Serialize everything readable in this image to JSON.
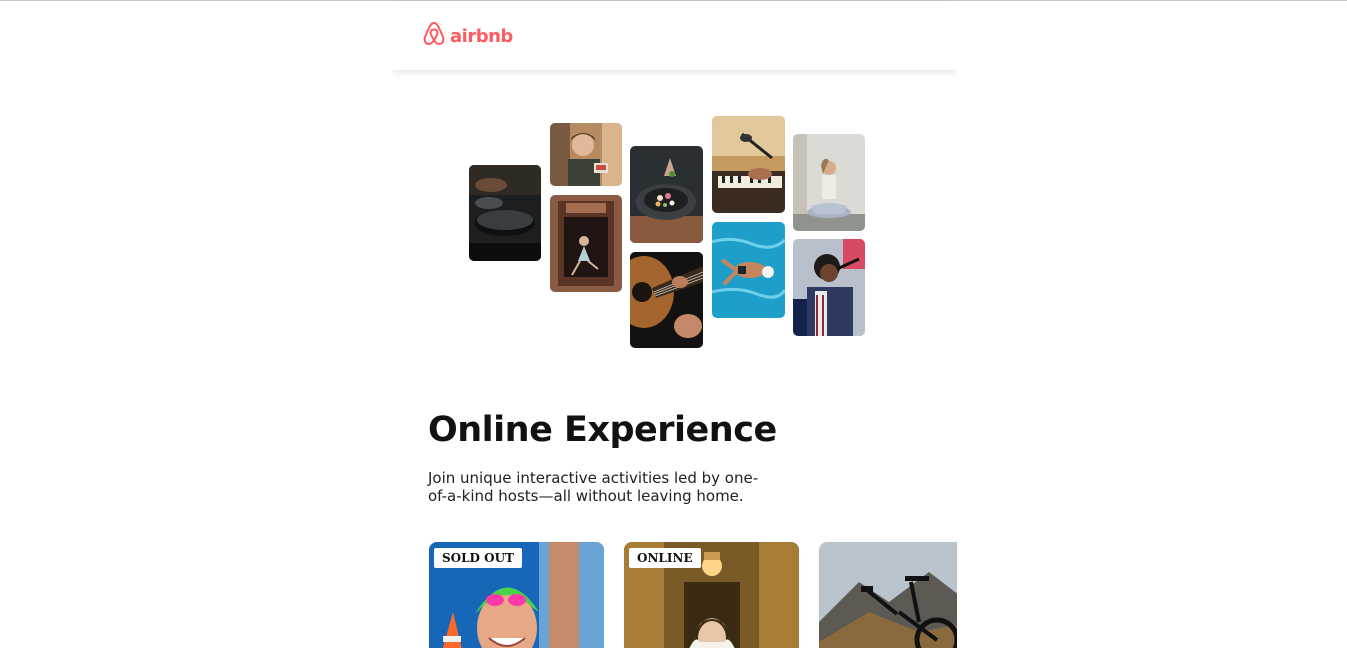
{
  "brand": {
    "name": "airbnb",
    "color": "#ff5a5f",
    "icon": "airbnb-logo-icon"
  },
  "hero": {
    "images": [
      "cooking-pans-photo",
      "chef-woman-photo",
      "dancer-doorway-photo",
      "food-bowl-photo",
      "guitar-photo",
      "microphone-keyboard-photo",
      "swimmer-photo",
      "yoga-photo",
      "singer-photo"
    ]
  },
  "main": {
    "title": "Online Experience",
    "subtitle": "Join unique interactive activities led by one-of-a-kind hosts—all without leaving home."
  },
  "cards": [
    {
      "badge": "SOLD OUT",
      "image": "swimmer-cap-photo"
    },
    {
      "badge": "ONLINE",
      "image": "bride-photo"
    },
    {
      "badge": "",
      "image": "mountain-bike-photo"
    }
  ]
}
